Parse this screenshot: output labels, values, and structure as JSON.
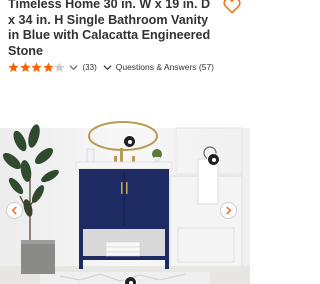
{
  "product": {
    "title": "Timeless Home 30 in. W x 19 in. D x 34 in. H Single Bathroom Vanity in Blue with Calacatta Engineered Stone",
    "favorite_icon": "heart-icon"
  },
  "rating": {
    "stars": 4,
    "max_stars": 5,
    "review_count": "(33)",
    "star_color": "#f96302",
    "star_empty_color": "#cccccc"
  },
  "qa": {
    "label": "Questions & Answers (57)",
    "icon": "chevron-down-icon"
  },
  "gallery": {
    "prev_icon": "chevron-left-icon",
    "next_icon": "chevron-right-icon",
    "hotspot_icon": "hotspot-dot-icon",
    "vanity_color": "#1e2b63"
  }
}
